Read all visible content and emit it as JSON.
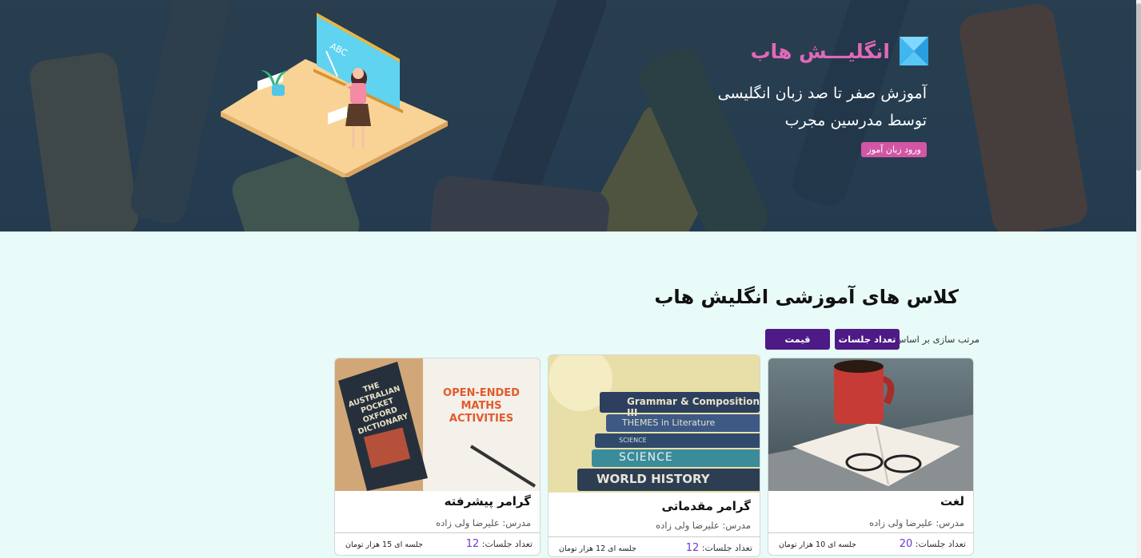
{
  "hero": {
    "brand_name": "انگلیـــش هاب",
    "headline_line1": "آموزش صفر تا صد زبان انگلیسی",
    "headline_line2": "توسط مدرسین مجرب",
    "login_button": "ورود زبان آموز",
    "board_text": "ABC",
    "colors": {
      "brand": "#e268b9",
      "button": "#d256a5"
    }
  },
  "section": {
    "title": "کلاس های آموزشی انگلیش هاب",
    "sort_label": "مرتب سازی بر اساس:",
    "sort_sessions": "تعداد جلسات",
    "sort_price": "قیمت",
    "accent_color": "#4e1a85"
  },
  "cards": [
    {
      "title": "لغت",
      "teacher": "مدرس: علیرضا ولی زاده",
      "sessions_label": "تعداد جلسات:",
      "sessions_count": "20",
      "price": "جلسه ای 10 هزار تومان",
      "image": "coffee-and-open-book"
    },
    {
      "title": "گرامر مقدماتی",
      "teacher": "مدرس: علیرضا ولی زاده",
      "sessions_label": "تعداد جلسات:",
      "sessions_count": "12",
      "price": "جلسه ای 12 هزار تومان",
      "image": "stack-of-books",
      "book_spines": [
        "Grammar & Composition III",
        "THEMES in Literature",
        "SCIENCE",
        "SCIENCE",
        "WORLD HISTORY"
      ]
    },
    {
      "title": "گرامر پیشرفته",
      "teacher": "مدرس: علیرضا ولی زاده",
      "sessions_label": "تعداد جلسات:",
      "sessions_count": "12",
      "price": "جلسه ای 15 هزار تومان",
      "image": "oxford-dictionary-and-maths-book",
      "book_texts": [
        "THE AUSTRALIAN POCKET OXFORD DICTIONARY",
        "OPEN-ENDED MATHS ACTIVITIES"
      ]
    }
  ]
}
